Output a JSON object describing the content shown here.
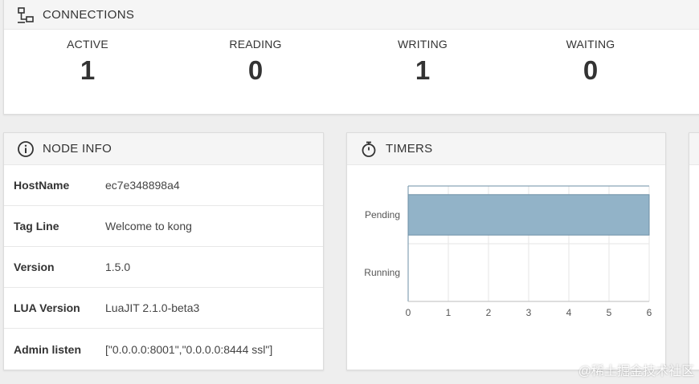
{
  "connections": {
    "title": "CONNECTIONS",
    "stats": [
      {
        "label": "ACTIVE",
        "value": "1"
      },
      {
        "label": "READING",
        "value": "0"
      },
      {
        "label": "WRITING",
        "value": "1"
      },
      {
        "label": "WAITING",
        "value": "0"
      }
    ]
  },
  "node_info": {
    "title": "NODE INFO",
    "rows": [
      {
        "key": "HostName",
        "value": "ec7e348898a4"
      },
      {
        "key": "Tag Line",
        "value": "Welcome to kong"
      },
      {
        "key": "Version",
        "value": "1.5.0"
      },
      {
        "key": "LUA Version",
        "value": "LuaJIT 2.1.0-beta3"
      },
      {
        "key": "Admin listen",
        "value": "[\"0.0.0.0:8001\",\"0.0.0.0:8444 ssl\"]"
      }
    ]
  },
  "timers": {
    "title": "TIMERS",
    "chart_data": {
      "type": "bar",
      "orientation": "horizontal",
      "categories": [
        "Pending",
        "Running"
      ],
      "values": [
        6,
        0
      ],
      "xlim": [
        0,
        6
      ],
      "xticks": [
        0,
        1,
        2,
        3,
        4,
        5,
        6
      ],
      "grid": true,
      "bar_color": "#92b3c8",
      "bar_border": "#6d8fa5"
    }
  },
  "watermark": "@稀土掘金技术社区",
  "icons": {
    "connections": "network-icon",
    "node_info": "info-icon",
    "timers": "stopwatch-icon"
  }
}
